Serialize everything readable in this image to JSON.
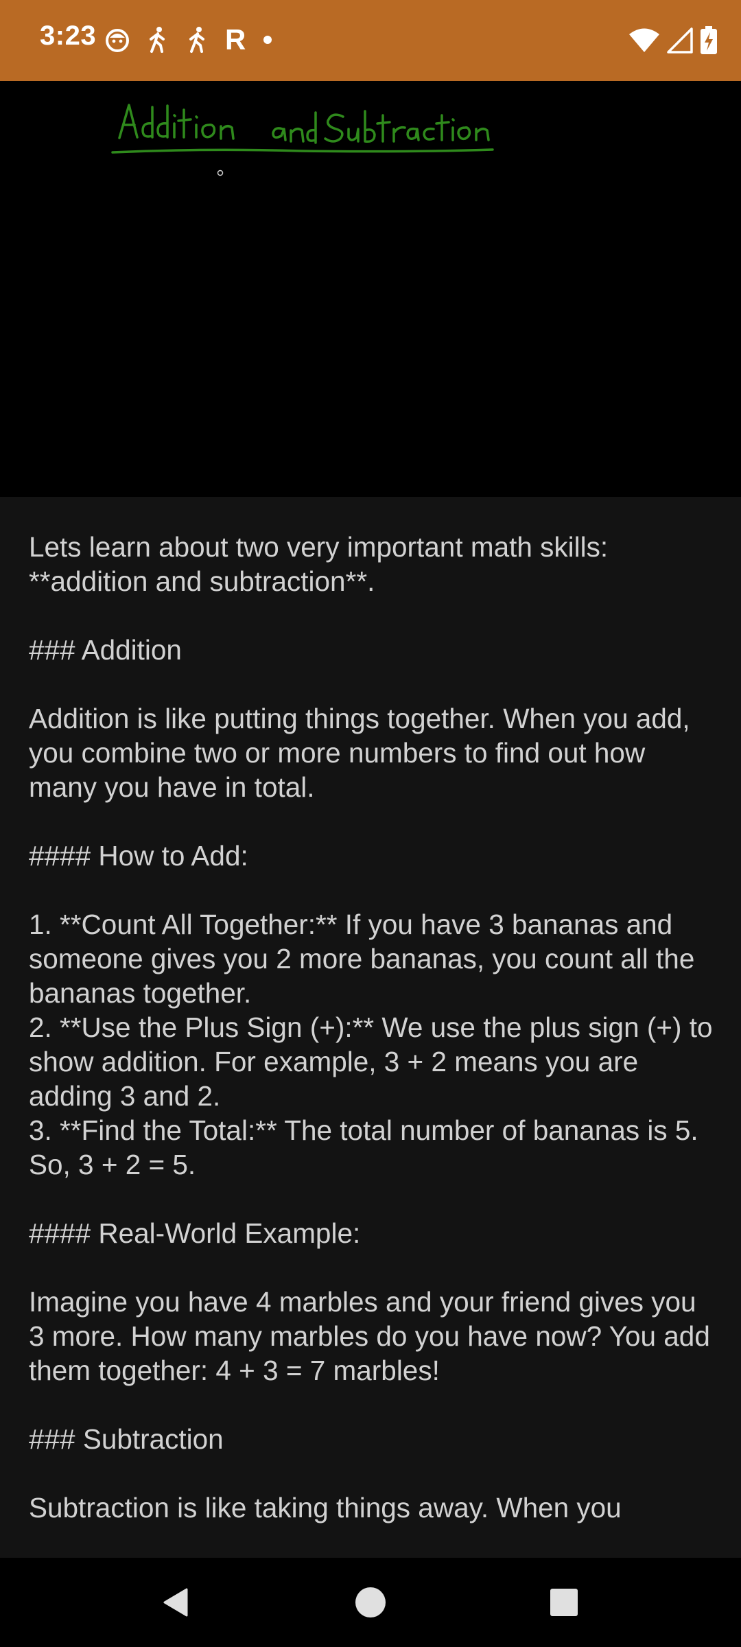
{
  "status_bar": {
    "time": "3:23",
    "carrier_letter": "R",
    "icons": [
      "face-icon",
      "walk-icon",
      "walk-icon",
      "dot-icon",
      "wifi-icon",
      "signal-icon",
      "battery-charging-icon"
    ]
  },
  "canvas": {
    "heading": "Addition and Subtraction",
    "ink_color": "#2f8a1c"
  },
  "lesson": {
    "paragraphs": [
      "Lets learn about two very important math skills: **addition and subtraction**.",
      "### Addition",
      "Addition is like putting things together. When you add, you combine two or more numbers to find out how many you have in total.",
      "#### How to Add:",
      "1. **Count All Together:** If you have 3 bananas and someone gives you 2 more bananas, you count all the bananas together.\n2. **Use the Plus Sign (+):** We use the plus sign (+) to show addition. For example, 3 + 2 means you are adding 3 and 2.\n3. **Find the Total:** The total number of bananas is 5. So, 3 + 2 = 5.",
      "#### Real-World Example:",
      "Imagine you have 4 marbles and your friend gives you 3 more. How many marbles do you have now? You add them together: 4 + 3 = 7 marbles!",
      "### Subtraction",
      "Subtraction is like taking things away. When you"
    ]
  },
  "colors": {
    "status_bar": "#b96a24",
    "canvas_background": "#000000",
    "content_background": "#131313",
    "text": "#d2d2d2"
  },
  "nav_bar": {
    "buttons": [
      "back-icon",
      "home-icon",
      "recents-icon"
    ]
  }
}
